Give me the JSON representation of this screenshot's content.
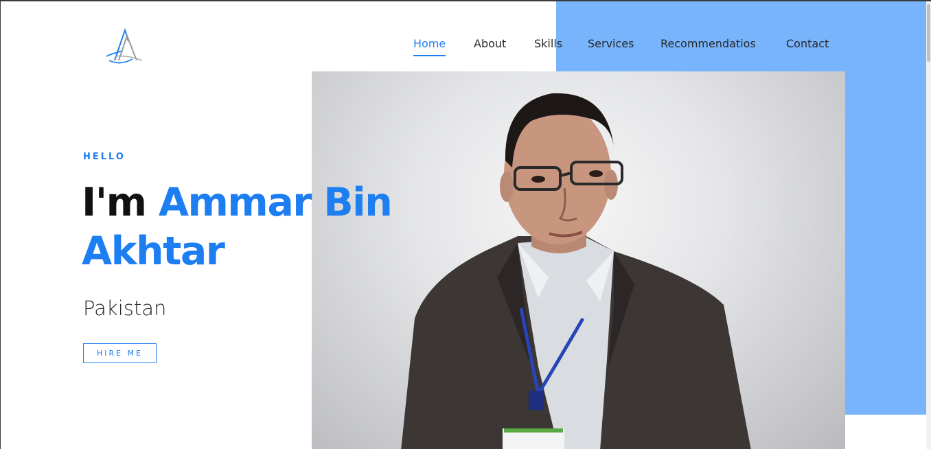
{
  "logo": {
    "letters": "AA",
    "icon": "logo-a-monogram-icon"
  },
  "nav": {
    "items": [
      {
        "label": "Home",
        "active": true
      },
      {
        "label": "About",
        "active": false
      },
      {
        "label": "Skills",
        "active": false
      },
      {
        "label": "Services",
        "active": false
      },
      {
        "label": "Recommendatios",
        "active": false
      },
      {
        "label": "Contact",
        "active": false
      }
    ]
  },
  "hero": {
    "greeting": "HELLO",
    "intro": "I'm",
    "name_line1": "Ammar Bin",
    "name_line2": "Akhtar",
    "location": "Pakistan",
    "cta_label": "HIRE ME"
  },
  "colors": {
    "accent": "#1d7ef2",
    "panel": "#78b4fb",
    "text": "#111111"
  }
}
